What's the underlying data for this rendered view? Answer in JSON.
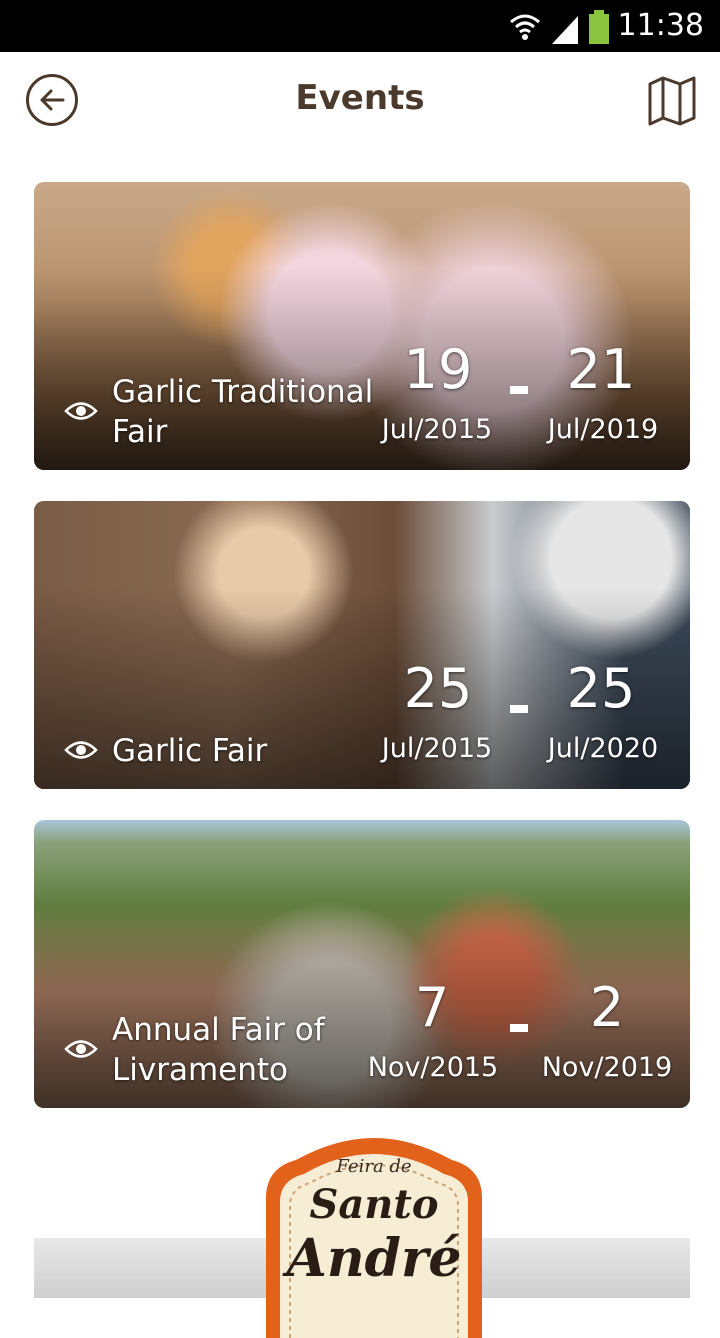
{
  "status_bar": {
    "time": "11:38"
  },
  "header": {
    "title": "Events"
  },
  "events": [
    {
      "name": "Garlic Traditional Fair",
      "start_day": "19",
      "start_month": "Jul/2015",
      "end_day": "21",
      "end_month": "Jul/2019"
    },
    {
      "name": "Garlic Fair",
      "start_day": "25",
      "start_month": "Jul/2015",
      "end_day": "25",
      "end_month": "Jul/2020"
    },
    {
      "name": "Annual Fair of Livramento",
      "start_day": "7",
      "start_month": "Nov/2015",
      "end_day": "2",
      "end_month": "Nov/2019"
    }
  ],
  "logo": {
    "line1": "Feira de",
    "line2": "Santo",
    "line3": "André"
  },
  "colors": {
    "accent": "#4b3a2c",
    "logo_orange": "#e2621b",
    "logo_cream": "#f7ecd4"
  }
}
